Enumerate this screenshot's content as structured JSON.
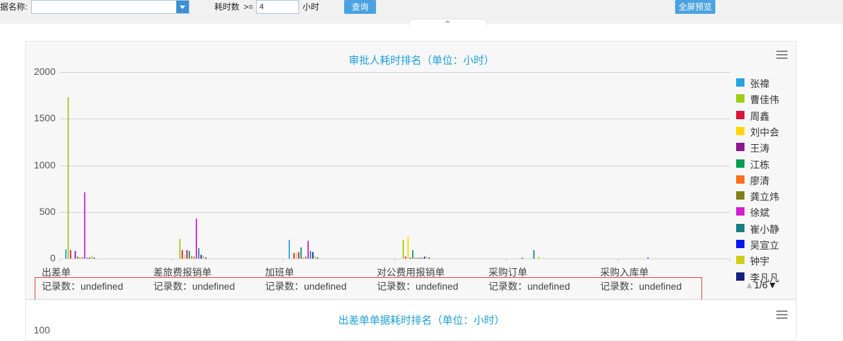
{
  "toolbar": {
    "name_label": "据名称:",
    "name_value": "",
    "hours_label": "耗时数",
    "operator": ">=",
    "hours_value": "4",
    "unit": "小时",
    "query_button": "查询",
    "fullscreen_button": "全屏预览"
  },
  "chart1": {
    "title": "审批人耗时排名（单位：小时）",
    "menu_icon": "hamburger-menu-icon",
    "pager": {
      "prev_icon": "triangle-up-icon",
      "text": "1/6",
      "next_icon": "triangle-down-icon"
    }
  },
  "chart2": {
    "title": "出差单单据耗时排名（单位：小时）",
    "first_tick": "100",
    "menu_icon": "hamburger-menu-icon"
  },
  "chart_data": {
    "type": "bar",
    "title": "审批人耗时排名（单位：小时）",
    "ylim": [
      0,
      2000
    ],
    "yticks": [
      "0",
      "500",
      "1000",
      "1500",
      "2000"
    ],
    "grid": true,
    "legend_position": "right",
    "categories": [
      "出差单",
      "差旅费报销单",
      "加班单",
      "对公费用报销单",
      "采购订单",
      "采购入库单"
    ],
    "record_label": "记录数：undefined",
    "series": [
      {
        "name": "张禕",
        "color": "#27a4dd",
        "values": [
          100,
          0,
          200,
          0,
          0,
          0
        ]
      },
      {
        "name": "曹佳伟",
        "color": "#9dcc16",
        "values": [
          1730,
          210,
          0,
          200,
          0,
          0
        ]
      },
      {
        "name": "周鑫",
        "color": "#dc143c",
        "values": [
          90,
          90,
          60,
          20,
          0,
          0
        ]
      },
      {
        "name": "刘中会",
        "color": "#ffd700",
        "values": [
          0,
          40,
          60,
          230,
          0,
          0
        ]
      },
      {
        "name": "王涛",
        "color": "#8b1a8b",
        "values": [
          80,
          90,
          70,
          10,
          10,
          0
        ]
      },
      {
        "name": "江栋",
        "color": "#089c54",
        "values": [
          20,
          80,
          120,
          90,
          0,
          0
        ]
      },
      {
        "name": "廖清",
        "color": "#ff6e1a",
        "values": [
          10,
          30,
          10,
          10,
          0,
          0
        ]
      },
      {
        "name": "龚立炜",
        "color": "#808018",
        "values": [
          15,
          20,
          20,
          10,
          0,
          0
        ]
      },
      {
        "name": "徐斌",
        "color": "#d21dd2",
        "values": [
          710,
          430,
          190,
          10,
          0,
          0
        ]
      },
      {
        "name": "崔小静",
        "color": "#168080",
        "values": [
          10,
          110,
          80,
          10,
          90,
          0
        ]
      },
      {
        "name": "吴宣立",
        "color": "#0b17f0",
        "values": [
          10,
          40,
          70,
          20,
          0,
          10
        ]
      },
      {
        "name": "钟宇",
        "color": "#cfcf1b",
        "values": [
          30,
          30,
          30,
          20,
          20,
          0
        ]
      },
      {
        "name": "李凡凡",
        "color": "#14217e",
        "values": [
          10,
          10,
          10,
          10,
          0,
          0
        ]
      }
    ]
  }
}
